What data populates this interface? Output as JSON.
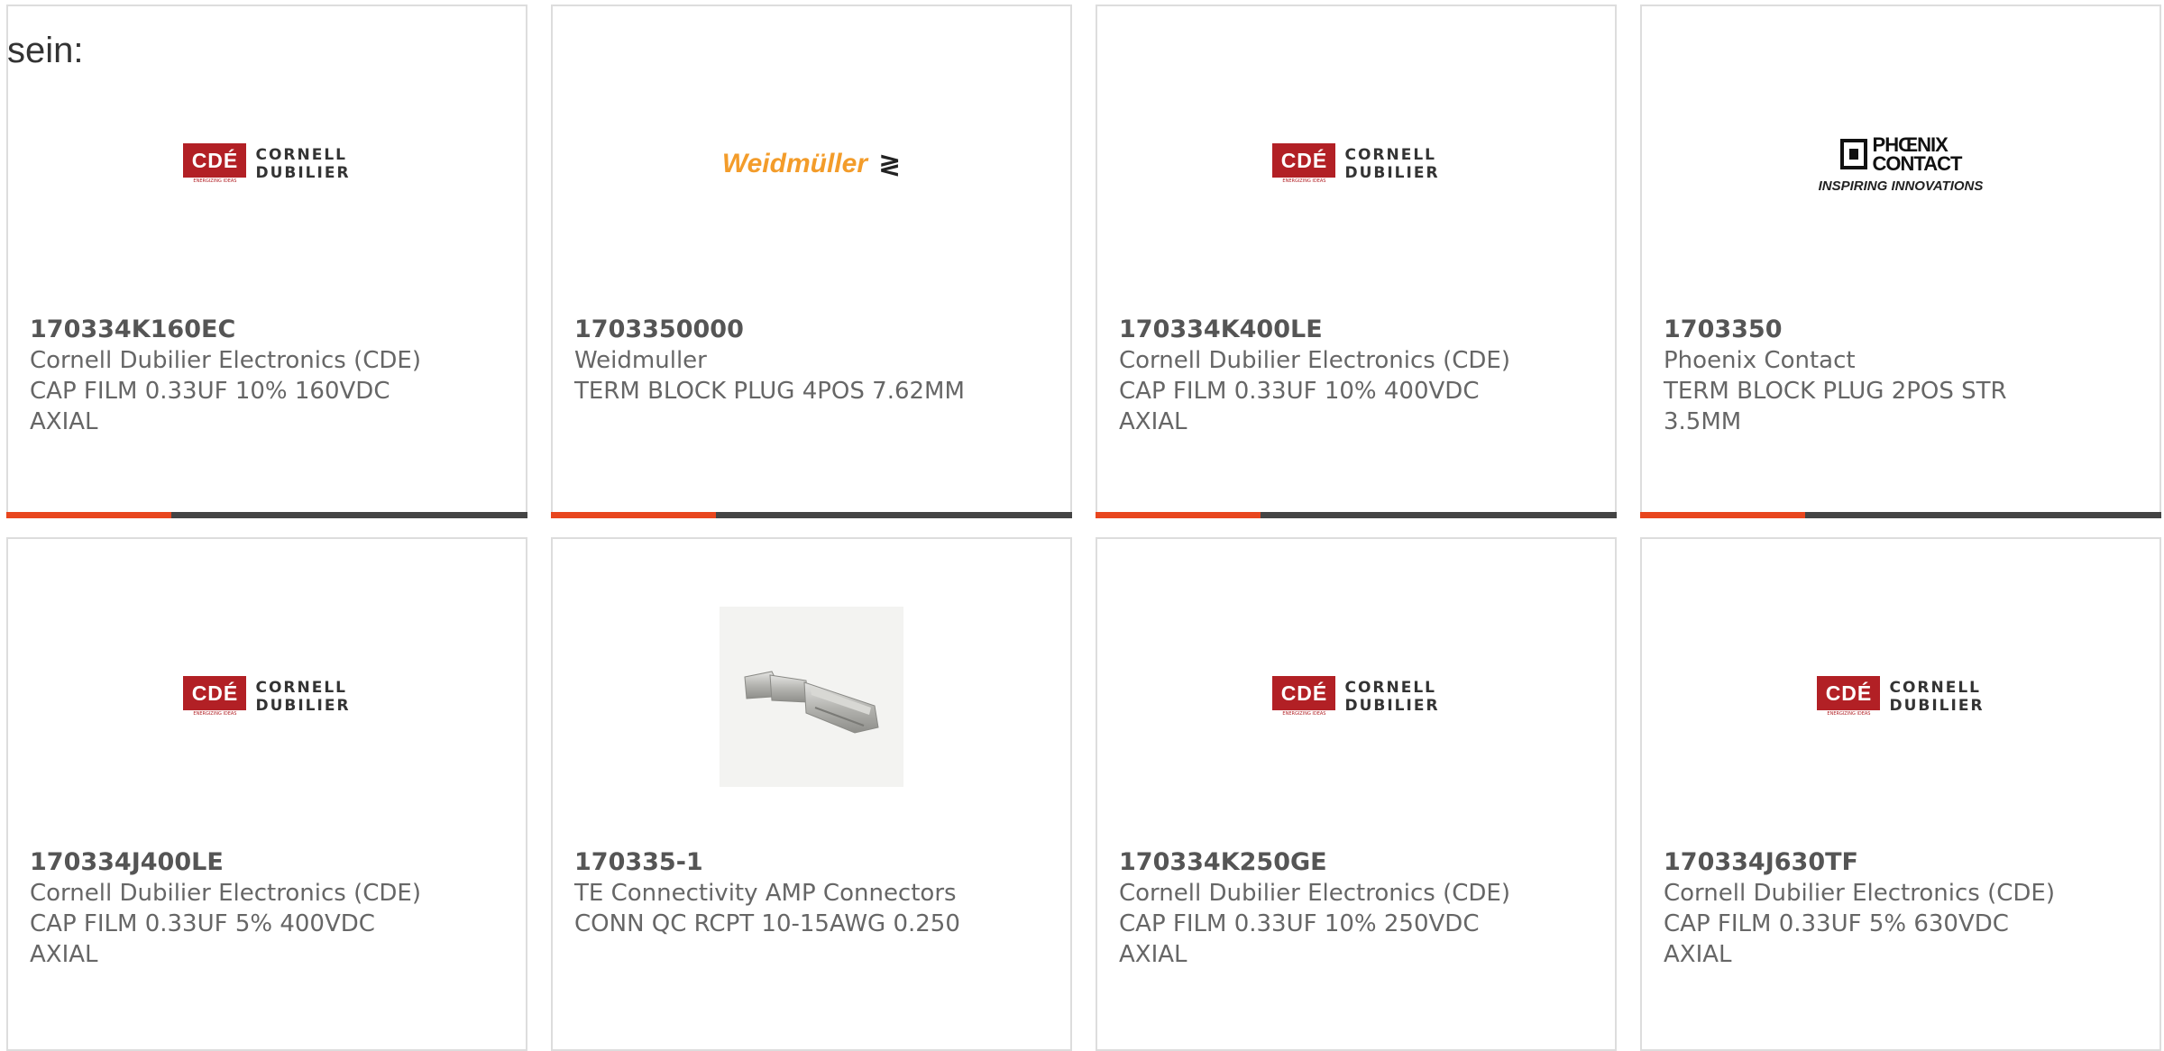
{
  "intro_text": "sein:",
  "logos": {
    "cde": {
      "badge": "CDÉ",
      "tagline": "ENERGIZING IDEAS",
      "line1": "CORNELL",
      "line2": "DUBILIER"
    },
    "weidmuller": {
      "name": "Weidmüller",
      "mark": "≷"
    },
    "phoenix": {
      "line1": "PHŒNIX",
      "line2": "CONTACT",
      "slogan": "INSPIRING INNOVATIONS"
    }
  },
  "colors": {
    "accent_orange": "#e8461e",
    "accent_dark": "#444444",
    "cde_red": "#b22025",
    "weidmuller_orange": "#f39c2a"
  },
  "products": [
    {
      "part_number": "170334K160EC",
      "manufacturer": "Cornell Dubilier Electronics (CDE)",
      "description": "CAP FILM 0.33UF 10% 160VDC AXIAL",
      "image": "cde-logo"
    },
    {
      "part_number": "1703350000",
      "manufacturer": "Weidmuller",
      "description": "TERM BLOCK PLUG 4POS 7.62MM",
      "image": "weidmuller-logo"
    },
    {
      "part_number": "170334K400LE",
      "manufacturer": "Cornell Dubilier Electronics (CDE)",
      "description": "CAP FILM 0.33UF 10% 400VDC AXIAL",
      "image": "cde-logo"
    },
    {
      "part_number": "1703350",
      "manufacturer": "Phoenix Contact",
      "description": "TERM BLOCK PLUG 2POS STR 3.5MM",
      "image": "phoenix-logo"
    },
    {
      "part_number": "170334J400LE",
      "manufacturer": "Cornell Dubilier Electronics (CDE)",
      "description": "CAP FILM 0.33UF 5% 400VDC AXIAL",
      "image": "cde-logo"
    },
    {
      "part_number": "170335-1",
      "manufacturer": "TE Connectivity AMP Connectors",
      "description": "CONN QC RCPT 10-15AWG 0.250",
      "image": "terminal-photo"
    },
    {
      "part_number": "170334K250GE",
      "manufacturer": "Cornell Dubilier Electronics (CDE)",
      "description": "CAP FILM 0.33UF 10% 250VDC AXIAL",
      "image": "cde-logo"
    },
    {
      "part_number": "170334J630TF",
      "manufacturer": "Cornell Dubilier Electronics (CDE)",
      "description": "CAP FILM 0.33UF 5% 630VDC AXIAL",
      "image": "cde-logo"
    }
  ]
}
